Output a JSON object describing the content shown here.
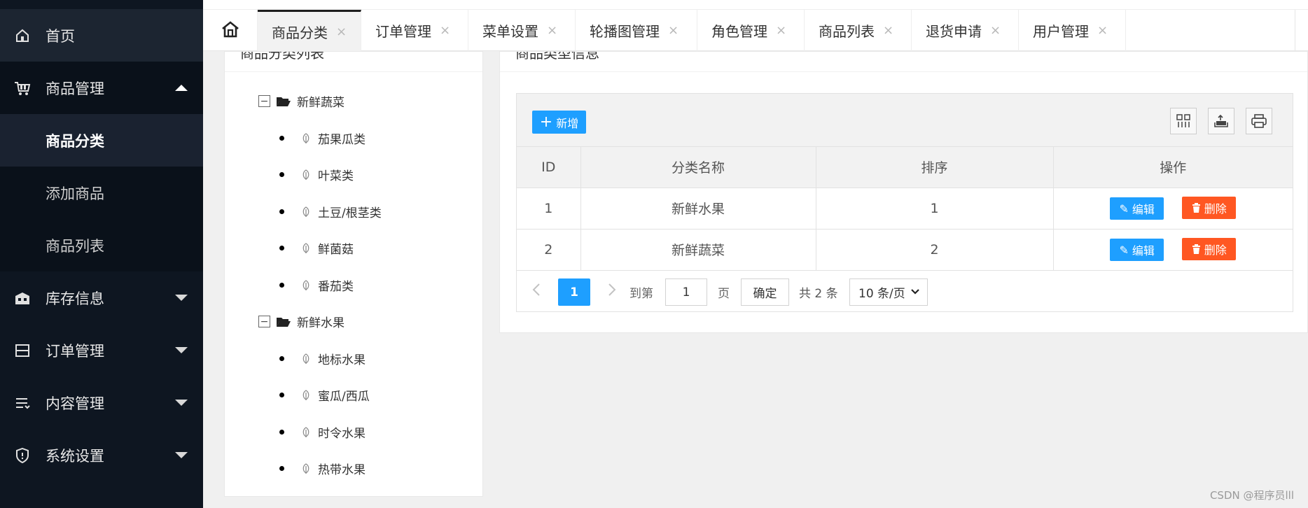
{
  "sidebar": {
    "items": [
      {
        "label": "首页",
        "icon": "home-icon"
      },
      {
        "label": "商品管理",
        "icon": "cart-icon",
        "expanded": true
      },
      {
        "label": "商品分类",
        "active": true
      },
      {
        "label": "添加商品"
      },
      {
        "label": "商品列表"
      },
      {
        "label": "库存信息",
        "icon": "warehouse-icon"
      },
      {
        "label": "订单管理",
        "icon": "order-icon"
      },
      {
        "label": "内容管理",
        "icon": "list-icon"
      },
      {
        "label": "系统设置",
        "icon": "shield-icon"
      }
    ]
  },
  "tabs": [
    {
      "label": "商品分类",
      "close": "×",
      "active": true
    },
    {
      "label": "订单管理",
      "close": "×"
    },
    {
      "label": "菜单设置",
      "close": "×"
    },
    {
      "label": "轮播图管理",
      "close": "×"
    },
    {
      "label": "角色管理",
      "close": "×"
    },
    {
      "label": "商品列表",
      "close": "×"
    },
    {
      "label": "退货申请",
      "close": "×"
    },
    {
      "label": "用户管理",
      "close": "×"
    }
  ],
  "tree": {
    "title": "商品分类列表",
    "groups": [
      {
        "toggle": "−",
        "label": "新鲜蔬菜",
        "children": [
          "茄果瓜类",
          "叶菜类",
          "土豆/根茎类",
          "鲜菌菇",
          "番茄类"
        ]
      },
      {
        "toggle": "−",
        "label": "新鲜水果",
        "children": [
          "地标水果",
          "蜜瓜/西瓜",
          "时令水果",
          "热带水果"
        ]
      }
    ]
  },
  "main": {
    "title": "商品类型信息",
    "add_label": "新增",
    "columns": [
      "ID",
      "分类名称",
      "排序",
      "操作"
    ],
    "rows": [
      {
        "id": "1",
        "name": "新鲜水果",
        "sort": "1"
      },
      {
        "id": "2",
        "name": "新鲜蔬菜",
        "sort": "2"
      }
    ],
    "edit_label": "编辑",
    "delete_label": "删除"
  },
  "pager": {
    "current": "1",
    "goto_label": "到第",
    "goto_value": "1",
    "page_label": "页",
    "confirm_label": "确定",
    "total_label": "共 2 条",
    "page_size": "10 条/页"
  },
  "watermark": "CSDN @程序员lll",
  "colors": {
    "primary": "#1e9fff",
    "danger": "#ff5722",
    "sidebar": "#0e1621"
  }
}
